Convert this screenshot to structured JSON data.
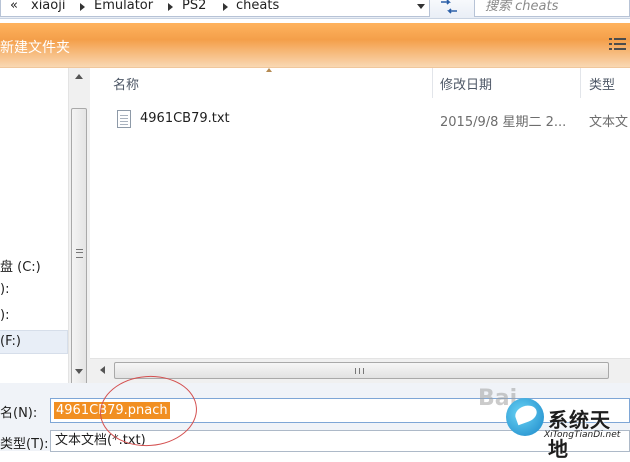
{
  "address_bar": {
    "overflow_glyph": "«",
    "breadcrumbs": [
      "xiaoji",
      "Emulator",
      "PS2",
      "cheats"
    ],
    "search_placeholder": "搜索 cheats"
  },
  "toolbar": {
    "new_folder_label": "新建文件夹"
  },
  "nav": {
    "items": [
      {
        "label": "盘 (C:)"
      },
      {
        "label": "):"
      },
      {
        "label": "):"
      },
      {
        "label": "(F:)"
      }
    ]
  },
  "file_list": {
    "columns": [
      "名称",
      "修改日期",
      "类型"
    ],
    "rows": [
      {
        "name": "4961CB79.txt",
        "modified": "2015/9/8 星期二 2...",
        "type": "文本文"
      }
    ]
  },
  "form": {
    "filename_label": "名(N):",
    "filename_value": "4961CB79.pnach",
    "filetype_label": "类型(T):",
    "filetype_value": "文本文档(*.txt)"
  },
  "watermark": {
    "site_name": "系统天地",
    "site_url": "XiTongTianDi.net",
    "baidu": "Bai"
  },
  "colors": {
    "toolbar_orange": "#f49f4a",
    "selection_orange": "#f18f22",
    "annotation_red": "#d45050"
  }
}
